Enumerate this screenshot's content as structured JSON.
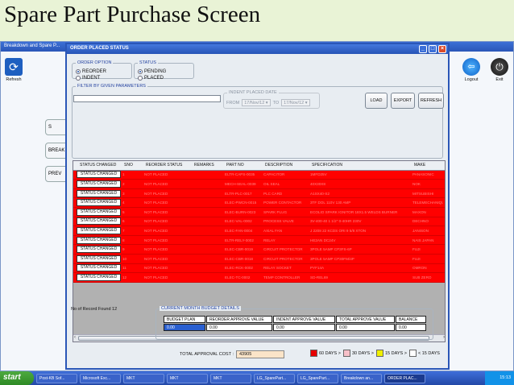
{
  "heading": "Spare Part Purchase Screen",
  "bg_window": {
    "title": "Breakdown and Spare P...",
    "refresh": "Refresh",
    "logout": "Logout",
    "exit": "Exit",
    "side_buttons": [
      "S",
      "BREAK",
      "PREV"
    ]
  },
  "dialog": {
    "title": "ORDER PLACED STATUS",
    "order_option": {
      "label": "ORDER OPTION",
      "options": [
        "REORDER",
        "INDENT"
      ],
      "selected": "REORDER"
    },
    "status": {
      "label": "STATUS",
      "options": [
        "PENDING",
        "PLACED"
      ],
      "selected": "PENDING"
    },
    "filter_label": "FILTER BY GIVEN PARAMETERS",
    "filter_value": "",
    "indent_date": {
      "label": "INDENT PLACED DATE",
      "from_label": "FROM",
      "to_label": "TO",
      "from": "17/Nov/12",
      "to": "17/Nov/12"
    },
    "buttons": {
      "load": "LOAD",
      "export": "EXPORT",
      "refresh": "REFRESH"
    },
    "columns": [
      "STATUS CHANGED",
      "SNO",
      "REORDER STATUS",
      "REMARKS",
      "PART NO",
      "DESCRIPTION",
      "SPECIFICATION",
      "MAKE"
    ],
    "rows": [
      {
        "btn": "STATUS CHANGED",
        "sno": "1",
        "status": "NOT PLACED",
        "remarks": "",
        "part": "ELTR-CAPS-0035",
        "desc": "CAPACITOR",
        "spec": "1MFD25V",
        "make": "PANASONIC"
      },
      {
        "btn": "STATUS CHANGED",
        "sno": "2",
        "status": "NOT PLACED",
        "remarks": "",
        "part": "MECH-SEAL-0039",
        "desc": "OIL SEAL",
        "spec": "40X30X8",
        "make": "NOK"
      },
      {
        "btn": "STATUS CHANGED",
        "sno": "3",
        "status": "NOT PLACED",
        "remarks": "",
        "part": "ELTR-PLC-0017",
        "desc": "PLC CARD",
        "spec": "A1SX40-S2",
        "make": "MITSUBISHI"
      },
      {
        "btn": "STATUS CHANGED",
        "sno": "4",
        "status": "NOT PLACED",
        "remarks": "",
        "part": "ELEC-PWCN-0015",
        "desc": "POWER CONTACTOR",
        "spec": "3TF DOL 110V 130 AMP",
        "make": "TELEMECHANIQUE"
      },
      {
        "btn": "STATUS CHANGED",
        "sno": "5",
        "status": "NOT PLACED",
        "remarks": "",
        "part": "ELEC-BURN-0023",
        "desc": "SPARK PLUG",
        "spec": "ECOLIO SPARK IGNITOR 18X1.5 WELDS BURNER",
        "make": "MAXON"
      },
      {
        "btn": "STATUS CHANGED",
        "sno": "6",
        "status": "NOT PLACED",
        "remarks": "",
        "part": "ELEC-VAL-0002",
        "desc": "PROCESS VALVE",
        "spec": "3V-400-40 1 1/2\" 0-40HR 230V",
        "make": "DECHNO"
      },
      {
        "btn": "STATUS CHANGED",
        "sno": "7",
        "status": "NOT PLACED",
        "remarks": "",
        "part": "ELEC-FAN-0004",
        "desc": "AXIAL FAN",
        "spec": "J 2208 22 KCDS ORI 9 5/8 XTON",
        "make": "JANISON"
      },
      {
        "btn": "STATUS CHANGED",
        "sno": "8",
        "status": "NOT PLACED",
        "remarks": "",
        "part": "ELTR-RELY-0002",
        "desc": "RELAY",
        "spec": "HE2AN DC24V",
        "make": "NAIS JAPAN"
      },
      {
        "btn": "STATUS CHANGED",
        "sno": "9",
        "status": "NOT PLACED",
        "remarks": "",
        "part": "ELEC-CBR-0019",
        "desc": "CIRCUIT PROTECTOR",
        "spec": "3POLE 5AMP CP3FS-6P",
        "make": "FUJI"
      },
      {
        "btn": "STATUS CHANGED",
        "sno": "10",
        "status": "NOT PLACED",
        "remarks": "",
        "part": "ELEC-CBR-0018",
        "desc": "CIRCUIT PROTECTOR",
        "spec": "3POLE 5AMP CP30FM/4P",
        "make": "FUJI"
      },
      {
        "btn": "STATUS CHANGED",
        "sno": "11",
        "status": "NOT PLACED",
        "remarks": "",
        "part": "ELEC-RCK-0002",
        "desc": "RELAY SOCKET",
        "spec": "PYF14A",
        "make": "OMRON"
      },
      {
        "btn": "STATUS CHANGED",
        "sno": "12",
        "status": "NOT PLACED",
        "remarks": "",
        "part": "ELEC-TC-0002",
        "desc": "TEMP CONTROLLER",
        "spec": "SD-REL69",
        "make": "SUB ZERO"
      }
    ],
    "record_count": "No of Record Found 12",
    "budget": {
      "label": "CURRENT MONTH BUDGET DETAILS",
      "headers": [
        "BUDGET PLAN",
        "REORDER APPROVE VALUE",
        "INDENT APPROVE VALUE",
        "TOTAL APPROVE VALUE",
        "BALANCE"
      ],
      "values": [
        "0.00",
        "0.00",
        "0.00",
        "0.00",
        "0.00"
      ]
    },
    "total_label": "TOTAL APPROVAL COST :",
    "total_value": "43905",
    "legend": [
      {
        "label": "60 DAYS >",
        "color": "#e60000"
      },
      {
        "label": "30 DAYS >",
        "color": "#f7c0c8"
      },
      {
        "label": "15 DAYS >",
        "color": "#f0f000"
      },
      {
        "label": "< 15 DAYS",
        "color": "#ffffff"
      }
    ]
  },
  "taskbar": {
    "start": "start",
    "tasks": [
      "Post-KB Sof...",
      "Microsoft Exc...",
      "MKT",
      "MKT",
      "MKT",
      "LG_SparePart...",
      "LG_SparePart...",
      "Breakdown an...",
      "ORDER PLAC..."
    ],
    "clock": "15:13"
  }
}
